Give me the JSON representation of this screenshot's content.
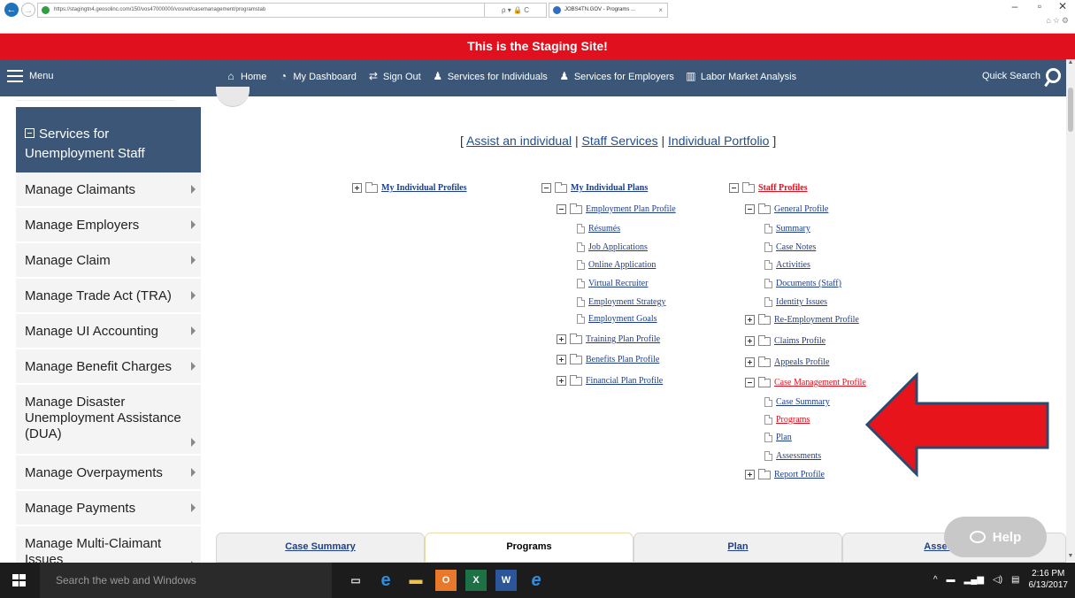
{
  "browser": {
    "url": "https://stagingtn4.geosolinc.com/150/vos47000000/vosnet/casemanagement/programstab",
    "url_tools": "ρ ▾ 🔒 C",
    "tab_title": "JOBS4TN.GOV - Programs ...",
    "tab_close": "×"
  },
  "banner": {
    "text": "This is the Staging Site!"
  },
  "topnav": {
    "menu_label": "Menu",
    "links": [
      {
        "label": "Home",
        "icon": "home-icon"
      },
      {
        "label": "My Dashboard",
        "icon": "dashboard-icon"
      },
      {
        "label": "Sign Out",
        "icon": "sign-out-icon"
      },
      {
        "label": "Services for Individuals",
        "icon": "individual-icon"
      },
      {
        "label": "Services for Employers",
        "icon": "employers-icon"
      },
      {
        "label": "Labor Market Analysis",
        "icon": "chart-icon"
      }
    ],
    "quick_search": "Quick Search"
  },
  "sidebar": {
    "heading": "Services for Unemployment Staff",
    "items": [
      "Manage Claimants",
      "Manage Employers",
      "Manage Claim",
      "Manage Trade Act (TRA)",
      "Manage UI Accounting",
      "Manage Benefit Charges",
      "Manage Disaster Unemployment Assistance (DUA)",
      "Manage Overpayments",
      "Manage Payments",
      "Manage Multi-Claimant Issues"
    ]
  },
  "quicklinks": {
    "open": "[",
    "assist": "Assist an individual",
    "sep1": "|",
    "staff_services": "Staff Services",
    "sep2": "|",
    "portfolio": "Individual Portfolio",
    "close": "]"
  },
  "tree": {
    "col1": {
      "root": "My Individual Profiles"
    },
    "col2": {
      "root": "My Individual Plans",
      "employment_plan": "Employment Plan Profile",
      "employment_items": [
        "Résumés",
        "Job Applications",
        "Online Application",
        "Virtual Recruiter",
        "Employment Strategy",
        "Employment Goals"
      ],
      "training": "Training Plan Profile",
      "benefits": "Benefits Plan Profile",
      "financial": "Financial Plan Profile"
    },
    "col3": {
      "root": "Staff Profiles",
      "general": "General Profile",
      "general_items": [
        "Summary",
        "Case Notes",
        "Activities",
        "Documents (Staff)",
        "Identity Issues"
      ],
      "reemployment": "Re-Employment Profile",
      "claims": "Claims Profile",
      "appeals": "Appeals Profile",
      "case_mgmt": "Case Management Profile",
      "case_items": [
        "Case Summary",
        "Programs",
        "Plan",
        "Assessments"
      ],
      "report": "Report Profile"
    }
  },
  "bottom_tabs": [
    "Case Summary",
    "Programs",
    "Plan",
    "Asses"
  ],
  "help": {
    "label": "Help"
  },
  "taskbar": {
    "search_placeholder": "Search the web and Windows",
    "time": "2:16 PM",
    "date": "6/13/2017"
  },
  "colors": {
    "banner": "#e0101e",
    "nav": "#3b5677",
    "arrow": "#e8141c",
    "arrow_border": "#2c4a6e"
  }
}
